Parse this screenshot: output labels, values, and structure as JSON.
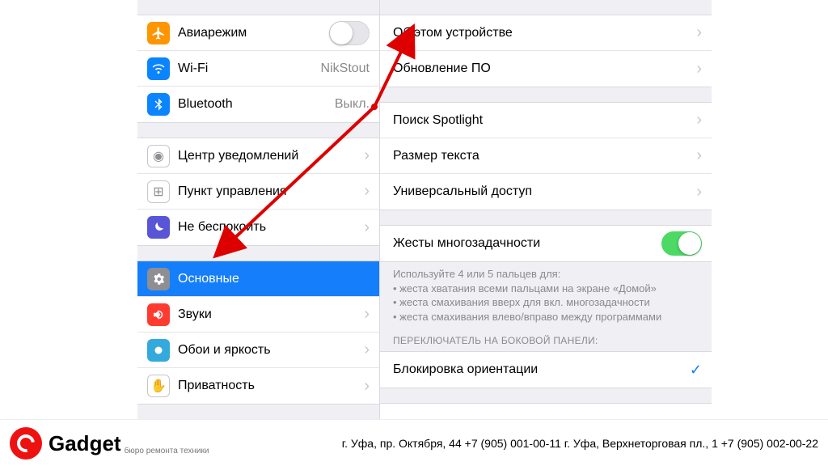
{
  "left": {
    "group1": [
      {
        "name": "airplane",
        "label": "Авиарежим",
        "icon": "airplane",
        "iconbg": "bg-orange",
        "toggle": false
      },
      {
        "name": "wifi",
        "label": "Wi-Fi",
        "icon": "wifi",
        "iconbg": "bg-blue",
        "value": "NikStout",
        "disclosure": true
      },
      {
        "name": "bluetooth",
        "label": "Bluetooth",
        "icon": "bluetooth",
        "iconbg": "bg-blue",
        "value": "Выкл.",
        "disclosure": true
      }
    ],
    "group2": [
      {
        "name": "notification-center",
        "label": "Центр уведомлений",
        "icon": "notification",
        "iconbg": "line",
        "disclosure": true
      },
      {
        "name": "control-center",
        "label": "Пункт управления",
        "icon": "control",
        "iconbg": "line",
        "disclosure": true
      },
      {
        "name": "do-not-disturb",
        "label": "Не беспокоить",
        "icon": "moon",
        "iconbg": "bg-indigo",
        "disclosure": true
      }
    ],
    "group3": [
      {
        "name": "general",
        "label": "Основные",
        "icon": "gear",
        "iconbg": "bg-gray",
        "selected": true,
        "disclosure": true
      },
      {
        "name": "sounds",
        "label": "Звуки",
        "icon": "sound",
        "iconbg": "bg-red",
        "disclosure": true
      },
      {
        "name": "wallpaper",
        "label": "Обои и яркость",
        "icon": "wallpaper",
        "iconbg": "bg-teal",
        "disclosure": true
      },
      {
        "name": "privacy",
        "label": "Приватность",
        "icon": "privacy",
        "iconbg": "line",
        "disclosure": true
      }
    ]
  },
  "right": {
    "group1": [
      {
        "name": "about",
        "label": "Об этом устройстве"
      },
      {
        "name": "software-update",
        "label": "Обновление ПО"
      }
    ],
    "group2": [
      {
        "name": "spotlight",
        "label": "Поиск Spotlight"
      },
      {
        "name": "text-size",
        "label": "Размер текста"
      },
      {
        "name": "accessibility",
        "label": "Универсальный доступ"
      }
    ],
    "multitask": {
      "label": "Жесты многозадачности",
      "toggle": true,
      "footer_lead": "Используйте 4 или 5 пальцев для:",
      "footer_l1": "• жеста хватания всеми пальцами на экране «Домой»",
      "footer_l2": "• жеста смахивания вверх для вкл. многозадачности",
      "footer_l3": "• жеста смахивания влево/вправо между программами"
    },
    "side_switch_header": "ПЕРЕКЛЮЧАТЕЛЬ НА БОКОВОЙ ПАНЕЛИ:",
    "side_switch": [
      {
        "name": "lock-rotation",
        "label": "Блокировка ориентации",
        "checked": true
      }
    ]
  },
  "brand": {
    "name": "Gadget",
    "tagline": "бюро ремонта техники",
    "address": "г. Уфа, пр. Октября, 44   +7 (905) 001-00-11 г. Уфа, Верхнеторговая пл., 1   +7 (905) 002-00-22"
  }
}
